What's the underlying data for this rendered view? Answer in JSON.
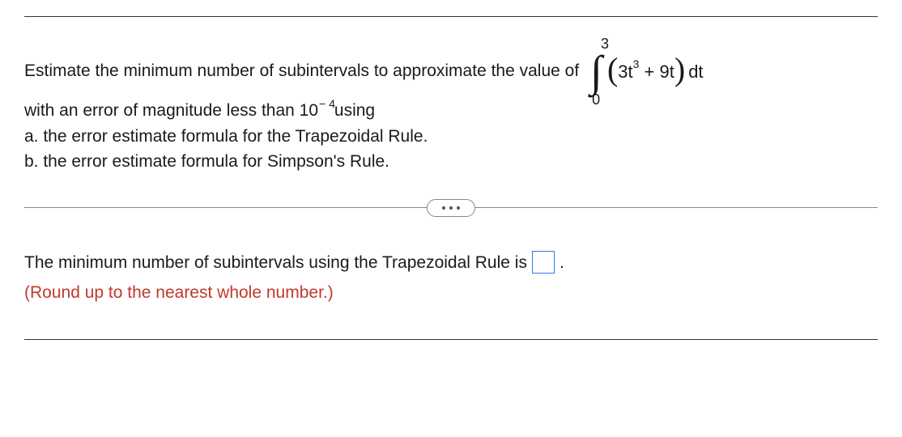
{
  "problem": {
    "intro": "Estimate the minimum number of subintervals to approximate the value of",
    "integral": {
      "lower": "0",
      "upper": "3",
      "coef1": "3t",
      "exp1": "3",
      "plus": " + 9t",
      "dt": "dt"
    },
    "line2a": "with an error of magnitude less than 10",
    "line2exp": "− 4",
    "line2b": " using",
    "part_a": "a. the error estimate formula for the Trapezoidal Rule.",
    "part_b": "b. the error estimate formula for Simpson's Rule."
  },
  "answer": {
    "prompt": "The minimum number of subintervals using the Trapezoidal Rule is",
    "period": ".",
    "hint": "(Round up to the nearest whole number.)"
  }
}
